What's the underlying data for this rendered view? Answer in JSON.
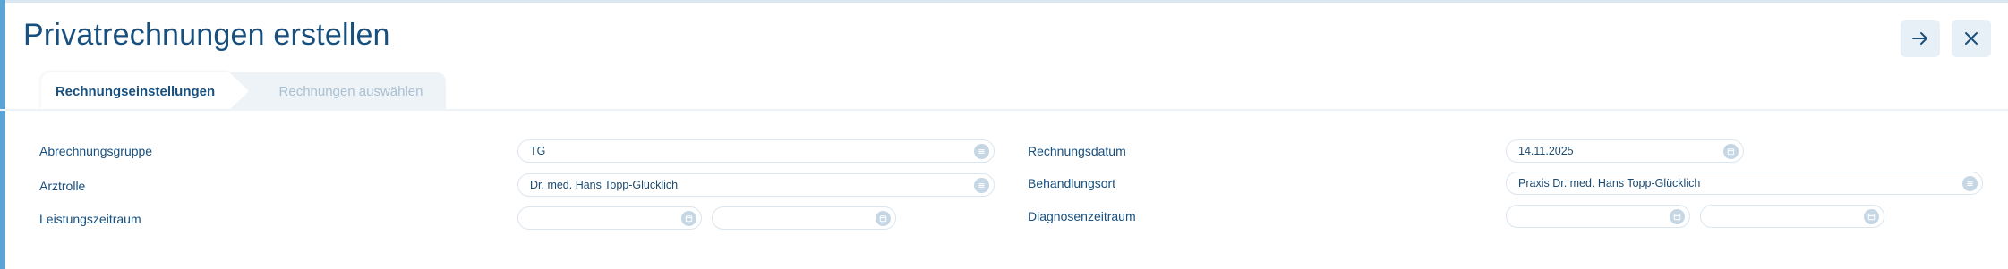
{
  "page": {
    "title": "Privatrechnungen erstellen",
    "accent_color": "#5aa5d6",
    "title_color": "#174f7e"
  },
  "header_buttons": [
    {
      "name": "next-button",
      "icon": "arrow-right-icon"
    },
    {
      "name": "close-button",
      "icon": "close-icon"
    }
  ],
  "tabs": [
    {
      "label": "Rechnungseinstellungen",
      "active": true
    },
    {
      "label": "Rechnungen auswählen",
      "active": false
    }
  ],
  "form_left": {
    "abrechnungsgruppe": {
      "label": "Abrechnungsgruppe",
      "value": "TG",
      "icon": "list-icon"
    },
    "arztrolle": {
      "label": "Arztrolle",
      "value": "Dr. med. Hans Topp-Glücklich",
      "icon": "list-icon"
    },
    "leistungszeitraum": {
      "label": "Leistungszeitraum",
      "from": "",
      "to": "",
      "icon": "calendar-icon"
    }
  },
  "form_right": {
    "rechnungsdatum": {
      "label": "Rechnungsdatum",
      "value": "14.11.2025",
      "icon": "calendar-icon"
    },
    "behandlungsort": {
      "label": "Behandlungsort",
      "value": "Praxis Dr. med. Hans Topp-Glücklich",
      "icon": "list-icon"
    },
    "diagnosenzeitraum": {
      "label": "Diagnosenzeitraum",
      "from": "",
      "to": "",
      "icon": "calendar-icon"
    }
  }
}
